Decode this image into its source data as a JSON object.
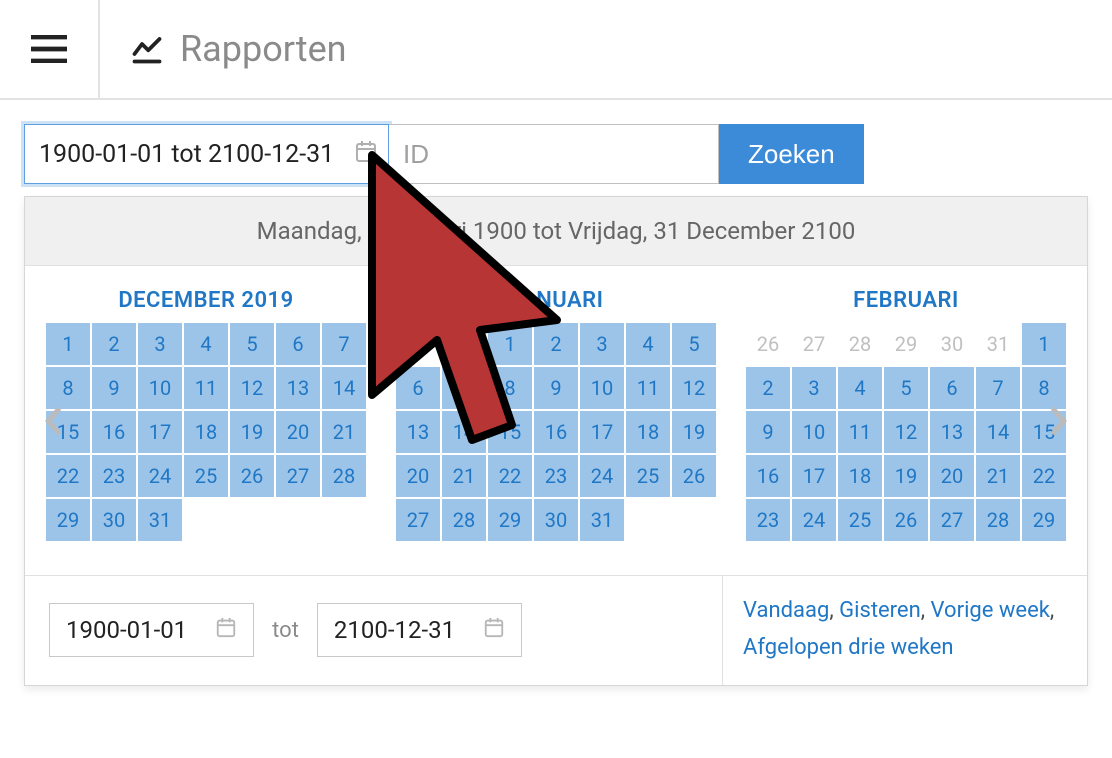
{
  "page": {
    "title": "Rapporten"
  },
  "search": {
    "date_range_display": "1900-01-01 tot 2100-12-31",
    "id_placeholder": "ID",
    "button_label": "Zoeken"
  },
  "picker": {
    "header_text": "Maandag, 1 Januari 1900 tot Vrijdag, 31 December 2100",
    "from_value": "1900-01-01",
    "separator": "tot",
    "to_value": "2100-12-31",
    "preset_labels": [
      "Vandaag",
      "Gisteren",
      "Vorige week",
      "Afgelopen drie weken"
    ],
    "months": [
      {
        "title": "DECEMBER 2019",
        "weeks": [
          [
            null,
            null,
            null,
            null,
            null,
            null,
            1
          ],
          [
            2,
            3,
            4,
            5,
            6,
            7,
            8
          ],
          [
            9,
            10,
            11,
            12,
            13,
            14,
            15
          ],
          [
            16,
            17,
            18,
            19,
            20,
            21,
            22
          ],
          [
            23,
            24,
            25,
            26,
            27,
            28,
            29
          ],
          [
            30,
            31,
            null,
            null,
            null,
            null,
            null
          ]
        ],
        "trailing_other_month_start": null,
        "leading_other_month": null
      },
      {
        "title": "JANUARI",
        "leading_other_month": [
          30,
          31
        ],
        "weeks": [
          [
            null,
            null,
            1,
            2,
            3,
            4,
            5
          ],
          [
            6,
            7,
            8,
            9,
            10,
            11,
            12
          ],
          [
            13,
            14,
            15,
            16,
            17,
            18,
            19
          ],
          [
            20,
            21,
            22,
            23,
            24,
            25,
            26
          ],
          [
            27,
            28,
            29,
            30,
            31,
            null,
            null
          ]
        ]
      },
      {
        "title": "FEBRUARI",
        "leading_other_month": [
          27,
          28,
          29,
          30,
          31
        ],
        "weeks": [
          [
            null,
            null,
            null,
            null,
            null,
            1,
            2
          ],
          [
            3,
            4,
            5,
            6,
            7,
            8,
            9
          ],
          [
            10,
            11,
            12,
            13,
            14,
            15,
            16
          ],
          [
            17,
            18,
            19,
            20,
            21,
            22,
            23
          ],
          [
            24,
            25,
            26,
            27,
            28,
            29,
            null
          ]
        ]
      }
    ]
  }
}
